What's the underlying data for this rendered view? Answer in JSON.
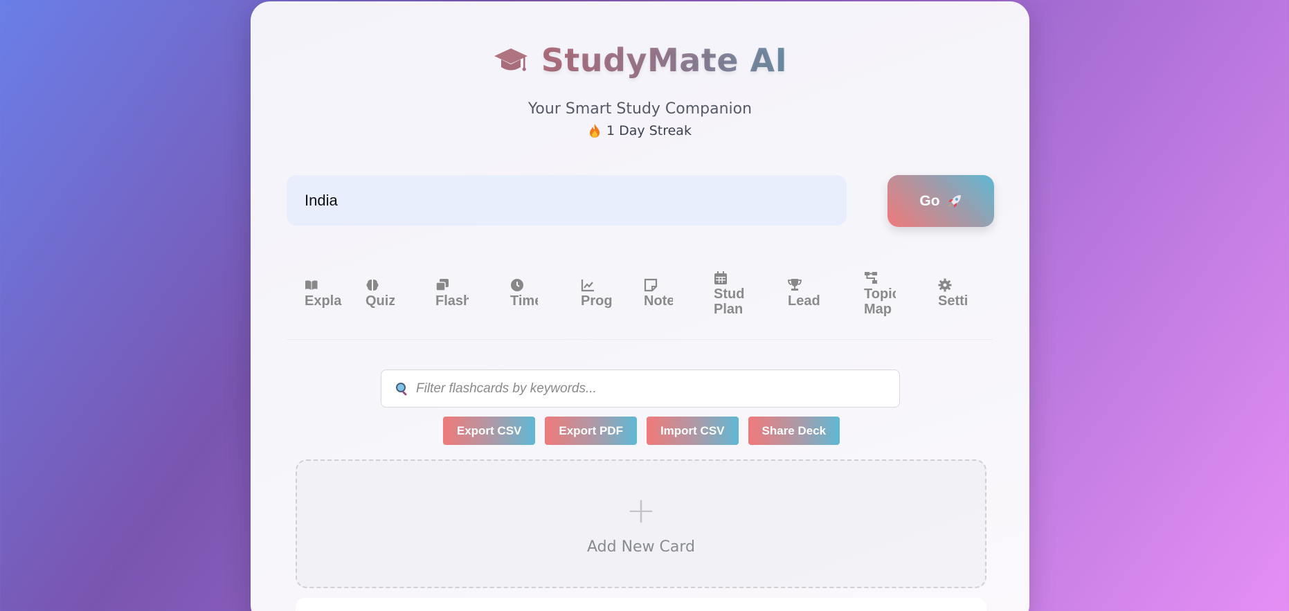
{
  "header": {
    "title": "StudyMate AI",
    "subtitle": "Your Smart Study Companion",
    "streak": "1 Day Streak",
    "icon": "graduation-cap-icon"
  },
  "search": {
    "value": "India",
    "go_label": "Go"
  },
  "tabs": [
    {
      "label": "Expla",
      "icon": "book-icon"
    },
    {
      "label": "Quiz",
      "icon": "brain-icon"
    },
    {
      "label": "Flash",
      "icon": "cards-icon"
    },
    {
      "label": "Time",
      "icon": "clock-icon"
    },
    {
      "label": "Prog",
      "icon": "chart-line-icon"
    },
    {
      "label": "Note",
      "icon": "note-icon"
    },
    {
      "label": "Stud",
      "label2": "Plan",
      "icon": "calendar-icon"
    },
    {
      "label": "Lead",
      "icon": "trophy-icon"
    },
    {
      "label": "Topic",
      "label2": "Map",
      "icon": "sitemap-icon"
    },
    {
      "label": "Setti",
      "icon": "gear-icon"
    }
  ],
  "filter": {
    "placeholder": "Filter flashcards by keywords..."
  },
  "actions": {
    "export_csv": "Export CSV",
    "export_pdf": "Export PDF",
    "import_csv": "Import CSV",
    "share_deck": "Share Deck"
  },
  "add_card": {
    "plus": "+",
    "label": "Add New Card"
  },
  "colors": {
    "accent_start": "#f07a7a",
    "accent_end": "#5fb8d4"
  }
}
